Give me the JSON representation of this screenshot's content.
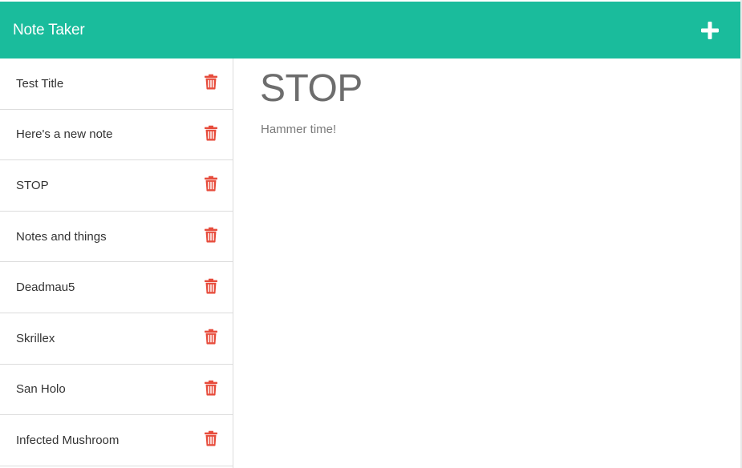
{
  "app": {
    "brand": "Note Taker",
    "add_icon": "plus-icon",
    "accent_color": "#1abc9c",
    "delete_color": "#e74c3c"
  },
  "sidebar": {
    "items": [
      {
        "label": "Test Title",
        "icon": "trash-icon"
      },
      {
        "label": "Here's a new note",
        "icon": "trash-icon"
      },
      {
        "label": "STOP",
        "icon": "trash-icon"
      },
      {
        "label": "Notes and things",
        "icon": "trash-icon"
      },
      {
        "label": "Deadmau5",
        "icon": "trash-icon"
      },
      {
        "label": "Skrillex",
        "icon": "trash-icon"
      },
      {
        "label": "San Holo",
        "icon": "trash-icon"
      },
      {
        "label": "Infected Mushroom",
        "icon": "trash-icon"
      }
    ]
  },
  "note": {
    "title": "STOP",
    "text": "Hammer time!"
  }
}
